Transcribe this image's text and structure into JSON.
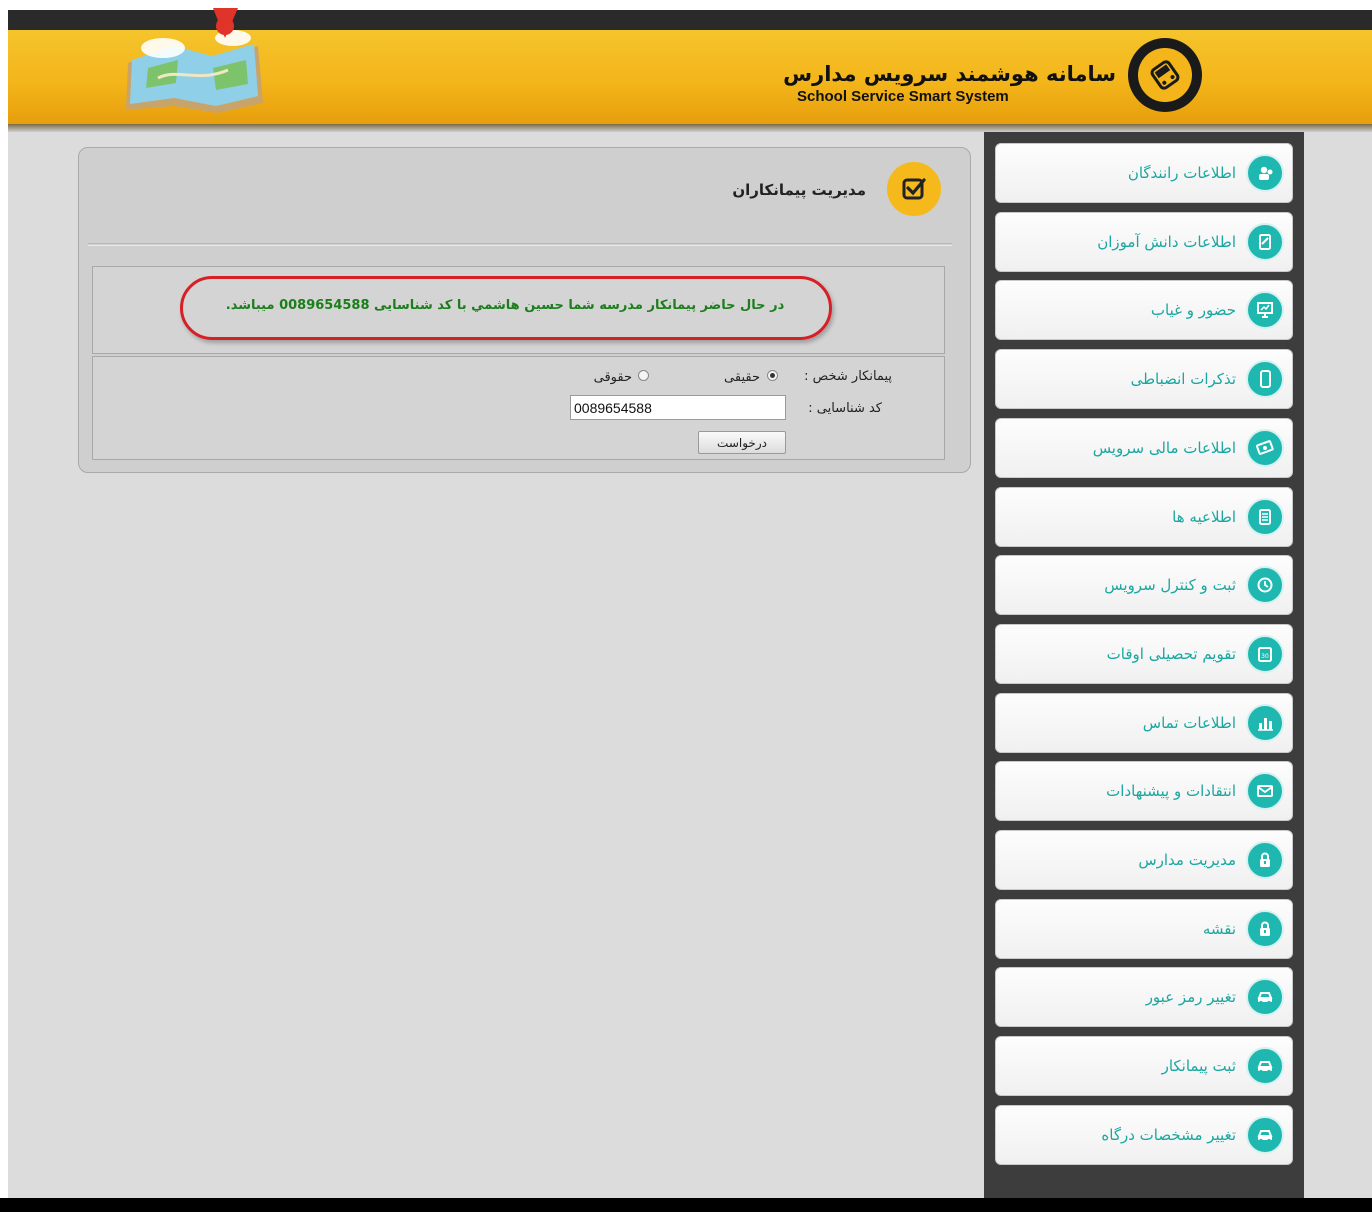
{
  "header": {
    "title": "سامانه هوشمند سرویس مدارس",
    "subtitle": "School Service Smart System"
  },
  "sidebar": {
    "items": [
      {
        "label": "اطلاعات رانندگان",
        "icon": "driver-icon"
      },
      {
        "label": "اطلاعات دانش آموزان",
        "icon": "student-icon"
      },
      {
        "label": "حضور و غیاب",
        "icon": "presentation-icon"
      },
      {
        "label": "تذکرات انضباطی",
        "icon": "phone-icon"
      },
      {
        "label": "اطلاعات مالی سرویس",
        "icon": "money-icon"
      },
      {
        "label": "اطلاعیه ها",
        "icon": "document-icon"
      },
      {
        "label": "ثبت و کنترل سرویس",
        "icon": "clock-icon"
      },
      {
        "label": "تقویم تحصیلی اوقات",
        "icon": "calendar-icon"
      },
      {
        "label": "اطلاعات تماس",
        "icon": "chart-icon"
      },
      {
        "label": "انتقادات و پیشنهادات",
        "icon": "mail-icon"
      },
      {
        "label": "مدیریت مدارس",
        "icon": "lock-icon"
      },
      {
        "label": "نقشه",
        "icon": "lock-icon"
      },
      {
        "label": "تغییر رمز عبور",
        "icon": "car-icon"
      },
      {
        "label": "ثبت پیمانکار",
        "icon": "car-icon"
      },
      {
        "label": "تغییر مشخصات درگاه",
        "icon": "car-icon"
      }
    ]
  },
  "panel": {
    "title": "مدیریت پیمانکاران",
    "message": "در حال حاضر پیمانکار مدرسه شما حسین هاشمي با کد شناسایی 0089654588 میباشد.",
    "contractor_label": "پیمانکار شخص :",
    "option_real": "حقیقی",
    "option_legal": "حقوقی",
    "selected_option": "حقیقی",
    "id_label": "کد شناسایی :",
    "id_value": "0089654588",
    "submit_label": "درخواست"
  },
  "colors": {
    "accent_teal": "#1fb8b0",
    "header_yellow": "#f3b51a",
    "message_green": "#1b7e1b",
    "highlight_red": "#d71f26"
  }
}
